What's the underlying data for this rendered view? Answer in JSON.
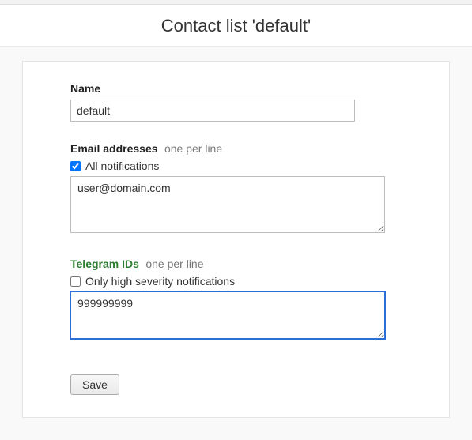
{
  "header": {
    "title": "Contact list 'default'"
  },
  "form": {
    "name": {
      "label": "Name",
      "value": "default"
    },
    "emails": {
      "label": "Email addresses",
      "hint": "one per line",
      "checkbox_label": "All notifications",
      "checkbox_checked": true,
      "value": "user@domain.com"
    },
    "telegram": {
      "label": "Telegram IDs",
      "hint": "one per line",
      "checkbox_label": "Only high severity notifications",
      "checkbox_checked": false,
      "value": "999999999"
    },
    "save_label": "Save"
  }
}
